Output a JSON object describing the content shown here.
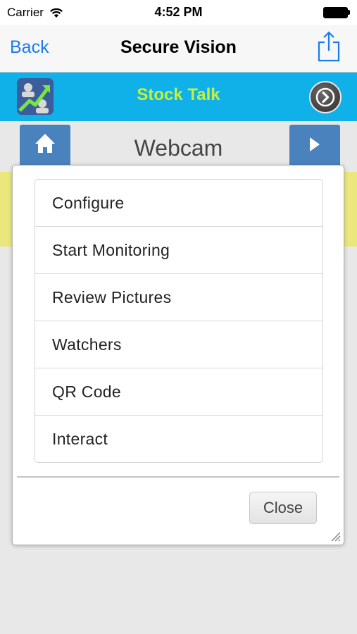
{
  "status_bar": {
    "carrier": "Carrier",
    "time": "4:52 PM",
    "wifi_icon": "wifi-icon",
    "battery_icon": "battery-icon"
  },
  "nav_bar": {
    "back_label": "Back",
    "title": "Secure Vision",
    "share_icon": "share-icon"
  },
  "app_header": {
    "title": "Stock Talk",
    "logo_icon": "stock-chart-logo-icon",
    "next_icon": "chevron-right-circle-icon",
    "background_color": "#10b0e8",
    "title_color": "#c6f03a"
  },
  "content": {
    "page_title": "Webcam",
    "home_icon": "home-icon",
    "forward_icon": "play-arrow-icon",
    "button_color": "#4a82bd",
    "band_color": "#ece77d"
  },
  "modal": {
    "menu_items": [
      {
        "label": "Configure"
      },
      {
        "label": "Start Monitoring"
      },
      {
        "label": "Review Pictures"
      },
      {
        "label": "Watchers"
      },
      {
        "label": "QR Code"
      },
      {
        "label": "Interact"
      }
    ],
    "close_label": "Close",
    "resize_icon": "resize-handle-icon"
  }
}
